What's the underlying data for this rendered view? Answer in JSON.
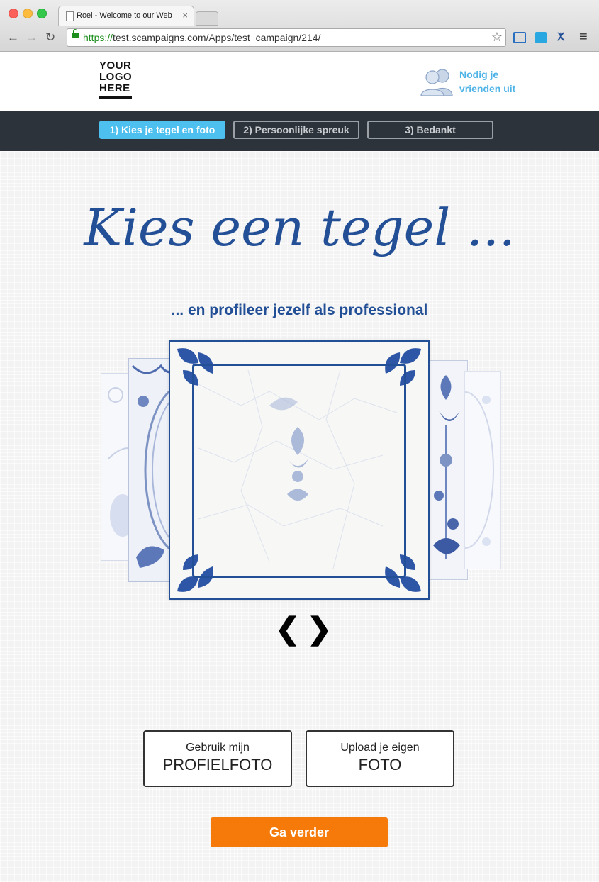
{
  "browser": {
    "tab_title": "Roel - Welcome to our Web",
    "tab_close": "×",
    "url_scheme": "https://",
    "url_rest": "test.scampaigns.com/Apps/test_campaign/214/",
    "back_icon": "←",
    "forward_icon": "→",
    "reload_icon": "↻",
    "star_icon": "☆",
    "menu_icon": "≡"
  },
  "header": {
    "logo_lines": [
      "YOUR",
      "LOGO",
      "HERE"
    ],
    "invite_line1": "Nodig je",
    "invite_line2": "vrienden uit"
  },
  "steps": [
    {
      "label": "1) Kies je tegel en foto",
      "active": true
    },
    {
      "label": "2) Persoonlijke spreuk",
      "active": false
    },
    {
      "label": "3) Bedankt",
      "active": false
    }
  ],
  "main": {
    "headline": "Kies een tegel ...",
    "subline": "... en profileer jezelf als professional",
    "prev_arrow": "❮",
    "next_arrow": "❯"
  },
  "buttons": {
    "profile_small": "Gebruik mijn",
    "profile_big": "PROFIELFOTO",
    "upload_small": "Upload je eigen",
    "upload_big": "FOTO",
    "continue": "Ga verder"
  },
  "colors": {
    "brand_blue": "#224f96",
    "accent_cyan": "#4ec0ef",
    "cta_orange": "#f67a0a",
    "nav_dark": "#2d333b"
  }
}
